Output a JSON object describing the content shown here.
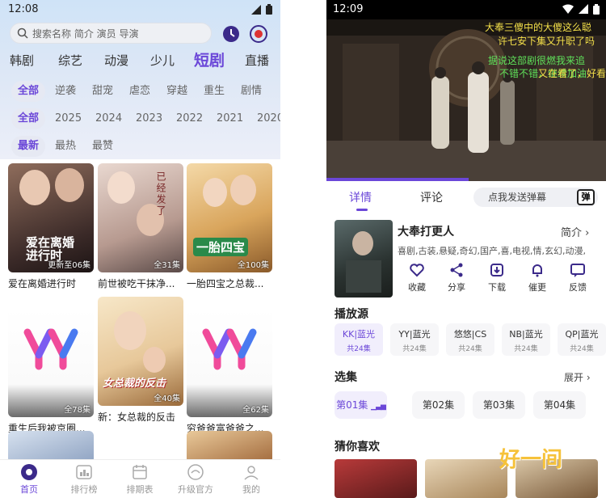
{
  "left": {
    "status_time": "12:08",
    "search_placeholder": "搜索名称 简介 演员 导演",
    "channels": [
      "韩剧",
      "综艺",
      "动漫",
      "少儿",
      "短剧",
      "直播"
    ],
    "active_channel": "短剧",
    "genres": [
      "全部",
      "逆袭",
      "甜宠",
      "虐恋",
      "穿越",
      "重生",
      "剧情"
    ],
    "years": [
      "全部",
      "2025",
      "2024",
      "2023",
      "2022",
      "2021",
      "2020"
    ],
    "sorts": [
      "最新",
      "最热",
      "最赞"
    ],
    "cards": [
      {
        "title": "爱在离婚进行时",
        "badge": "更新至06集"
      },
      {
        "title": "前世被吃干抹净...",
        "badge": "全31集"
      },
      {
        "title": "一胎四宝之总裁...",
        "badge": "全100集"
      },
      {
        "title": "重生后我被京圈...",
        "badge": "全78集"
      },
      {
        "title": "新：女总裁的反击",
        "badge": "全40集"
      },
      {
        "title": "穷爸爸富爸爸之...",
        "badge": "全62集"
      }
    ],
    "poster_texts": [
      "爱在离婚进行时",
      "已经发了",
      "一胎四宝",
      "女总裁的反击"
    ],
    "nav": [
      "首页",
      "排行榜",
      "排期表",
      "升级官方",
      "我的"
    ]
  },
  "right": {
    "status_time": "12:09",
    "danmaku": [
      "大奉三傻中的大傻这么聪",
      "许七安下集又升职了吗",
      "据说这部剧很燃我来追",
      "不错不错，继续加油",
      "又在看了，好看"
    ],
    "tabs": [
      "详情",
      "评论"
    ],
    "danmu_placeholder": "点我发送弹幕",
    "danmu_toggle": "弹",
    "title": "大奉打更人",
    "intro_label": "简介",
    "tags": "喜剧,古装,悬疑,奇幻,国产,喜,电视,情,玄幻,动漫,",
    "actions": [
      "收藏",
      "分享",
      "下载",
      "催更",
      "反馈"
    ],
    "sources_label": "播放源",
    "sources": [
      {
        "name": "KK|蓝光",
        "count": "共24集"
      },
      {
        "name": "YY|蓝光",
        "count": "共24集"
      },
      {
        "name": "悠悠|CS",
        "count": "共24集"
      },
      {
        "name": "NB|蓝光",
        "count": "共24集"
      },
      {
        "name": "QP|蓝光",
        "count": "共24集"
      }
    ],
    "episodes_label": "选集",
    "expand_label": "展开",
    "episodes": [
      "第01集",
      "第02集",
      "第03集",
      "第04集"
    ],
    "guess_label": "猜你喜欢",
    "watermark": "好一间"
  },
  "colors": {
    "accent": "#6b47d8"
  }
}
